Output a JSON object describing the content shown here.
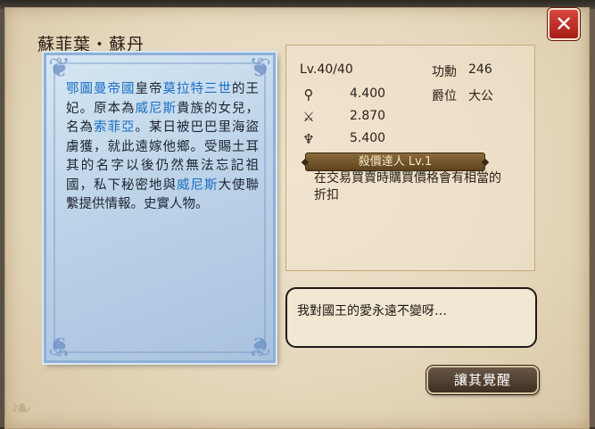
{
  "title": "蘇菲葉・蘇丹",
  "close_label": "✕",
  "bio": {
    "parts": [
      {
        "t": "鄂圖曼帝國",
        "hl": true
      },
      {
        "t": "皇帝",
        "hl": false
      },
      {
        "t": "莫拉特三世",
        "hl": true
      },
      {
        "t": "的王妃。原本為",
        "hl": false
      },
      {
        "t": "威尼斯",
        "hl": true
      },
      {
        "t": "貴族的女兒，名為",
        "hl": false
      },
      {
        "t": "索菲亞",
        "hl": true
      },
      {
        "t": "。某日被巴巴里海盜虜獲，就此遠嫁他鄉。受賜土耳其的名字以後仍然無法忘記祖國，私下秘密地與",
        "hl": false
      },
      {
        "t": "威尼斯",
        "hl": true
      },
      {
        "t": "大使聯繫提供情報。史實人物。",
        "hl": false
      }
    ]
  },
  "stats": {
    "level": "Lv.40/40",
    "merit_label": "功勳",
    "merit_value": "246",
    "search_value": "4.400",
    "combat_value": "2.870",
    "rank_label": "爵位",
    "rank_value": "大公",
    "stat3_value": "5.400",
    "skill_name": "殺價達人 Lv.1",
    "skill_desc": "在交易買賣時購買價格會有相當的折扣"
  },
  "speech": "我對國王的愛永遠不變呀…",
  "awaken_label": "讓其覺醒",
  "icons": [
    "search-icon",
    "sword-icon",
    "bird-icon",
    "close-icon"
  ]
}
